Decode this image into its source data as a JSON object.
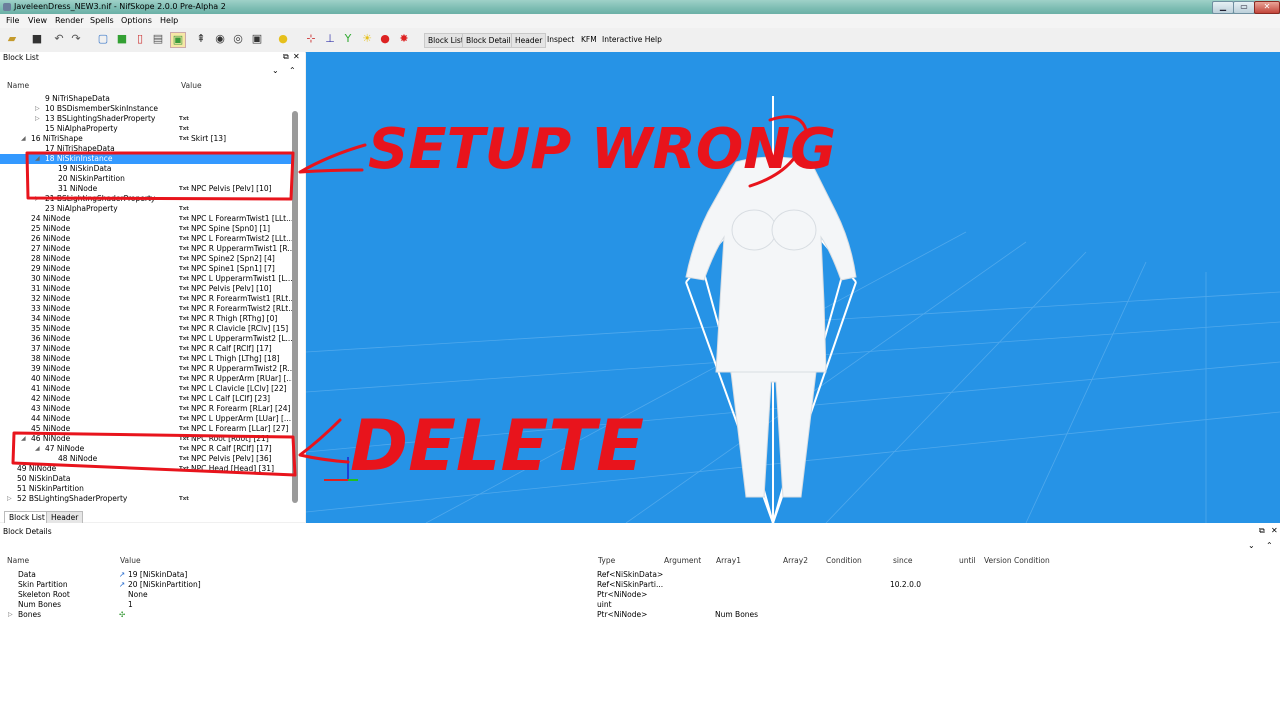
{
  "window": {
    "title": "JaveleenDress_NEW3.nif - NifSkope 2.0.0 Pre-Alpha 2"
  },
  "menu": [
    "File",
    "View",
    "Render",
    "Spells",
    "Options",
    "Help"
  ],
  "toolbar": {
    "buttons": [
      "Block List",
      "Block Details",
      "Header",
      "Inspect",
      "KFM",
      "Interactive Help"
    ]
  },
  "block_list": {
    "title": "Block List",
    "col_name": "Name",
    "col_value": "Value",
    "rows": [
      {
        "name": "9 NiTriShapeData",
        "txt": "",
        "value": ""
      },
      {
        "name": "10 BSDismemberSkinInstance",
        "txt": "",
        "value": ""
      },
      {
        "name": "13 BSLightingShaderProperty",
        "txt": "Txt",
        "value": ""
      },
      {
        "name": "15 NiAlphaProperty",
        "txt": "Txt",
        "value": ""
      },
      {
        "name": "16 NiTriShape",
        "txt": "Txt",
        "value": "Skirt [13]"
      },
      {
        "name": "17 NiTriShapeData",
        "txt": "",
        "value": ""
      },
      {
        "name": "18 NiSkinInstance",
        "txt": "",
        "value": ""
      },
      {
        "name": "19 NiSkinData",
        "txt": "",
        "value": ""
      },
      {
        "name": "20 NiSkinPartition",
        "txt": "",
        "value": ""
      },
      {
        "name": "31 NiNode",
        "txt": "Txt",
        "value": "NPC Pelvis [Pelv] [10]"
      },
      {
        "name": "21 BSLightingShaderProperty",
        "txt": "",
        "value": ""
      },
      {
        "name": "23 NiAlphaProperty",
        "txt": "Txt",
        "value": ""
      },
      {
        "name": "24 NiNode",
        "txt": "Txt",
        "value": "NPC L ForearmTwist1 [LLt..."
      },
      {
        "name": "25 NiNode",
        "txt": "Txt",
        "value": "NPC Spine [Spn0] [1]"
      },
      {
        "name": "26 NiNode",
        "txt": "Txt",
        "value": "NPC L ForearmTwist2 [LLt..."
      },
      {
        "name": "27 NiNode",
        "txt": "Txt",
        "value": "NPC R UpperarmTwist1 [R..."
      },
      {
        "name": "28 NiNode",
        "txt": "Txt",
        "value": "NPC Spine2 [Spn2] [4]"
      },
      {
        "name": "29 NiNode",
        "txt": "Txt",
        "value": "NPC Spine1 [Spn1] [7]"
      },
      {
        "name": "30 NiNode",
        "txt": "Txt",
        "value": "NPC L UpperarmTwist1 [L..."
      },
      {
        "name": "31 NiNode",
        "txt": "Txt",
        "value": "NPC Pelvis [Pelv] [10]"
      },
      {
        "name": "32 NiNode",
        "txt": "Txt",
        "value": "NPC R ForearmTwist1 [RLt..."
      },
      {
        "name": "33 NiNode",
        "txt": "Txt",
        "value": "NPC R ForearmTwist2 [RLt..."
      },
      {
        "name": "34 NiNode",
        "txt": "Txt",
        "value": "NPC R Thigh [RThg] [0]"
      },
      {
        "name": "35 NiNode",
        "txt": "Txt",
        "value": "NPC R Clavicle [RClv] [15]"
      },
      {
        "name": "36 NiNode",
        "txt": "Txt",
        "value": "NPC L UpperarmTwist2 [L..."
      },
      {
        "name": "37 NiNode",
        "txt": "Txt",
        "value": "NPC R Calf [RClf] [17]"
      },
      {
        "name": "38 NiNode",
        "txt": "Txt",
        "value": "NPC L Thigh [LThg] [18]"
      },
      {
        "name": "39 NiNode",
        "txt": "Txt",
        "value": "NPC R UpperarmTwist2 [R..."
      },
      {
        "name": "40 NiNode",
        "txt": "Txt",
        "value": "NPC R UpperArm [RUar] [..."
      },
      {
        "name": "41 NiNode",
        "txt": "Txt",
        "value": "NPC L Clavicle [LClv] [22]"
      },
      {
        "name": "42 NiNode",
        "txt": "Txt",
        "value": "NPC L Calf [LClf] [23]"
      },
      {
        "name": "43 NiNode",
        "txt": "Txt",
        "value": "NPC R Forearm [RLar] [24]"
      },
      {
        "name": "44 NiNode",
        "txt": "Txt",
        "value": "NPC L UpperArm [LUar] [..."
      },
      {
        "name": "45 NiNode",
        "txt": "Txt",
        "value": "NPC L Forearm [LLar] [27]"
      },
      {
        "name": "46 NiNode",
        "txt": "Txt",
        "value": "NPC Root [Root] [21]"
      },
      {
        "name": "47 NiNode",
        "txt": "Txt",
        "value": "NPC R Calf [RClf] [17]"
      },
      {
        "name": "48 NiNode",
        "txt": "Txt",
        "value": "NPC Pelvis [Pelv] [36]"
      },
      {
        "name": "49 NiNode",
        "txt": "Txt",
        "value": "NPC Head [Head] [31]"
      },
      {
        "name": "50 NiSkinData",
        "txt": "",
        "value": ""
      },
      {
        "name": "51 NiSkinPartition",
        "txt": "",
        "value": ""
      },
      {
        "name": "52 BSLightingShaderProperty",
        "txt": "Txt",
        "value": ""
      }
    ],
    "tabs": [
      "Block List",
      "Header"
    ]
  },
  "block_details": {
    "title": "Block Details",
    "columns": [
      "Name",
      "Value",
      "Type",
      "Argument",
      "Array1",
      "Array2",
      "Condition",
      "since",
      "until",
      "Version Condition"
    ],
    "rows": [
      {
        "name": "Data",
        "value": "19 [NiSkinData]",
        "type": "Ref<NiSkinData>",
        "array1": "",
        "since": ""
      },
      {
        "name": "Skin Partition",
        "value": "20 [NiSkinPartition]",
        "type": "Ref<NiSkinParti...",
        "array1": "",
        "since": "10.2.0.0"
      },
      {
        "name": "Skeleton Root",
        "value": "None",
        "type": "Ptr<NiNode>",
        "array1": "",
        "since": ""
      },
      {
        "name": "Num Bones",
        "value": "1",
        "type": "uint",
        "array1": "",
        "since": ""
      },
      {
        "name": "Bones",
        "value": "",
        "type": "Ptr<NiNode>",
        "array1": "Num Bones",
        "since": ""
      }
    ]
  },
  "annotations": {
    "setup": "SETUP WRONG",
    "delete": "DELETE"
  },
  "colors": {
    "viewport": "#2693e6",
    "selection": "#3399ff",
    "annotation": "#e8141c"
  }
}
